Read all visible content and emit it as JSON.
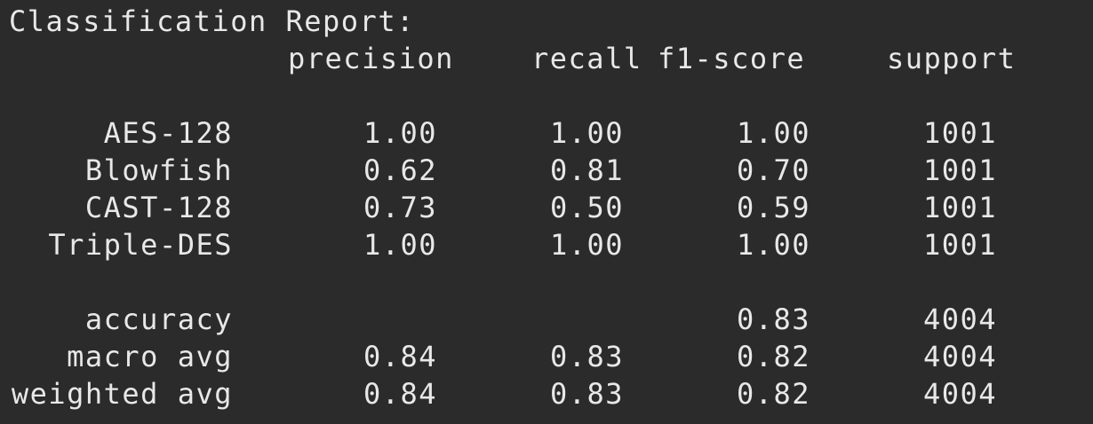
{
  "report": {
    "title": "Classification Report:",
    "headers": {
      "precision": "precision",
      "recall": "recall",
      "f1": "f1-score",
      "support": "support"
    },
    "classes": [
      {
        "label": "AES-128",
        "precision": "1.00",
        "recall": "1.00",
        "f1": "1.00",
        "support": "1001"
      },
      {
        "label": "Blowfish",
        "precision": "0.62",
        "recall": "0.81",
        "f1": "0.70",
        "support": "1001"
      },
      {
        "label": "CAST-128",
        "precision": "0.73",
        "recall": "0.50",
        "f1": "0.59",
        "support": "1001"
      },
      {
        "label": "Triple-DES",
        "precision": "1.00",
        "recall": "1.00",
        "f1": "1.00",
        "support": "1001"
      }
    ],
    "summary": [
      {
        "label": "accuracy",
        "precision": "",
        "recall": "",
        "f1": "0.83",
        "support": "4004"
      },
      {
        "label": "macro avg",
        "precision": "0.84",
        "recall": "0.83",
        "f1": "0.82",
        "support": "4004"
      },
      {
        "label": "weighted avg",
        "precision": "0.84",
        "recall": "0.83",
        "f1": "0.82",
        "support": "4004"
      }
    ]
  },
  "colors": {
    "background": "#2b2b2b",
    "text": "#e8e8e8"
  }
}
